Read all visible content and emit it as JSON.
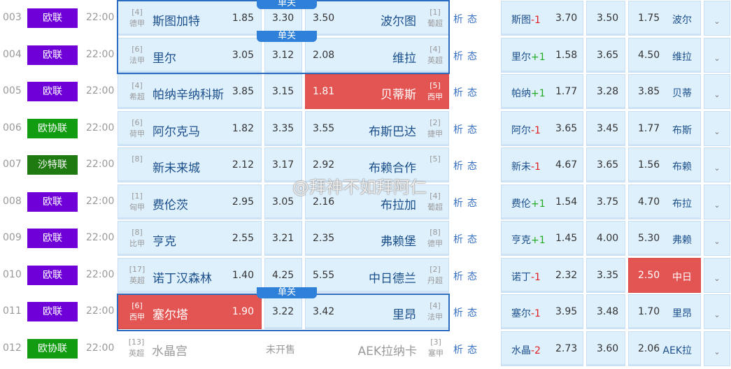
{
  "colors": {
    "europa": "#7000d8",
    "conference": "#129c12",
    "saudi": "#1f7a12",
    "highlight": "#e35552",
    "cell": "#dff0fd",
    "link": "#3a72c2"
  },
  "analysis_label": "析",
  "form_label": "态",
  "single_label": "单关",
  "unsold_label": "未开售",
  "watermark": "@拜神不如拜阿仁",
  "rows": [
    {
      "num": "003",
      "league": "欧联",
      "league_color": "europa",
      "time": "22:00",
      "home_rank": "[4]",
      "home_league": "德甲",
      "home": "斯图加特",
      "win": "1.85",
      "draw": "3.30",
      "lose": "3.50",
      "away": "波尔图",
      "away_rank": "[1]",
      "away_league": "葡超",
      "hc_team": "斯图",
      "hc": "-1",
      "hc_win": "3.70",
      "hc_draw": "3.50",
      "hc_lose": "1.75",
      "hc_away": "波尔",
      "single": true,
      "red": ""
    },
    {
      "num": "004",
      "league": "欧联",
      "league_color": "europa",
      "time": "22:00",
      "home_rank": "[6]",
      "home_league": "法甲",
      "home": "里尔",
      "win": "3.05",
      "draw": "3.12",
      "lose": "2.08",
      "away": "维拉",
      "away_rank": "[4]",
      "away_league": "英超",
      "hc_team": "里尔",
      "hc": "+1",
      "hc_win": "1.58",
      "hc_draw": "3.65",
      "hc_lose": "4.50",
      "hc_away": "维拉",
      "single": true,
      "red": ""
    },
    {
      "num": "005",
      "league": "欧联",
      "league_color": "europa",
      "time": "22:00",
      "home_rank": "[4]",
      "home_league": "希超",
      "home": "帕纳辛纳科斯",
      "win": "3.85",
      "draw": "3.15",
      "lose": "1.81",
      "away": "贝蒂斯",
      "away_rank": "[5]",
      "away_league": "西甲",
      "hc_team": "帕纳",
      "hc": "+1",
      "hc_win": "1.77",
      "hc_draw": "3.28",
      "hc_lose": "3.85",
      "hc_away": "贝蒂",
      "single": false,
      "red": "lose"
    },
    {
      "num": "006",
      "league": "欧协联",
      "league_color": "conference",
      "time": "22:00",
      "home_rank": "[6]",
      "home_league": "荷甲",
      "home": "阿尔克马",
      "win": "1.82",
      "draw": "3.35",
      "lose": "3.55",
      "away": "布斯巴达",
      "away_rank": "[2]",
      "away_league": "捷甲",
      "hc_team": "阿尔",
      "hc": "-1",
      "hc_win": "3.65",
      "hc_draw": "3.45",
      "hc_lose": "1.77",
      "hc_away": "布斯",
      "single": false,
      "red": ""
    },
    {
      "num": "007",
      "league": "沙特联",
      "league_color": "saudi",
      "time": "22:00",
      "home_rank": "[8]",
      "home_league": "",
      "home": "新未来城",
      "win": "2.12",
      "draw": "3.17",
      "lose": "2.92",
      "away": "布赖合作",
      "away_rank": "[5]",
      "away_league": "",
      "hc_team": "新未",
      "hc": "-1",
      "hc_win": "4.67",
      "hc_draw": "3.65",
      "hc_lose": "1.56",
      "hc_away": "布赖",
      "single": false,
      "red": ""
    },
    {
      "num": "008",
      "league": "欧联",
      "league_color": "europa",
      "time": "22:00",
      "home_rank": "[1]",
      "home_league": "匈甲",
      "home": "费伦茨",
      "win": "2.95",
      "draw": "3.05",
      "lose": "2.16",
      "away": "布拉加",
      "away_rank": "[4]",
      "away_league": "葡超",
      "hc_team": "费伦",
      "hc": "+1",
      "hc_win": "1.54",
      "hc_draw": "3.75",
      "hc_lose": "4.70",
      "hc_away": "布拉",
      "single": false,
      "red": ""
    },
    {
      "num": "009",
      "league": "欧联",
      "league_color": "europa",
      "time": "22:00",
      "home_rank": "[8]",
      "home_league": "比甲",
      "home": "亨克",
      "win": "2.55",
      "draw": "3.21",
      "lose": "2.35",
      "away": "弗赖堡",
      "away_rank": "[8]",
      "away_league": "德甲",
      "hc_team": "亨克",
      "hc": "+1",
      "hc_win": "1.45",
      "hc_draw": "4.00",
      "hc_lose": "5.30",
      "hc_away": "弗赖",
      "single": false,
      "red": ""
    },
    {
      "num": "010",
      "league": "欧联",
      "league_color": "europa",
      "time": "22:00",
      "home_rank": "[17]",
      "home_league": "英超",
      "home": "诺丁汉森林",
      "win": "1.40",
      "draw": "4.25",
      "lose": "5.55",
      "away": "中日德兰",
      "away_rank": "[2]",
      "away_league": "丹超",
      "hc_team": "诺丁",
      "hc": "-1",
      "hc_win": "2.32",
      "hc_draw": "3.35",
      "hc_lose": "2.50",
      "hc_away": "中日",
      "single": false,
      "red": "hc_lose"
    },
    {
      "num": "011",
      "league": "欧联",
      "league_color": "europa",
      "time": "22:00",
      "home_rank": "[6]",
      "home_league": "西甲",
      "home": "塞尔塔",
      "win": "1.90",
      "draw": "3.22",
      "lose": "3.42",
      "away": "里昂",
      "away_rank": "[4]",
      "away_league": "法甲",
      "hc_team": "塞尔",
      "hc": "-1",
      "hc_win": "3.95",
      "hc_draw": "3.48",
      "hc_lose": "1.70",
      "hc_away": "里昂",
      "single": true,
      "red": "win"
    },
    {
      "num": "012",
      "league": "欧协联",
      "league_color": "conference",
      "time": "22:00",
      "home_rank": "[13]",
      "home_league": "英超",
      "home": "水晶宫",
      "unsold": true,
      "away": "AEK拉纳卡",
      "away_rank": "[3]",
      "away_league": "塞甲",
      "hc_team": "水晶",
      "hc": "-2",
      "hc_win": "2.73",
      "hc_draw": "3.60",
      "hc_lose": "2.06",
      "hc_away": "AEK拉",
      "single": false,
      "red": ""
    }
  ]
}
